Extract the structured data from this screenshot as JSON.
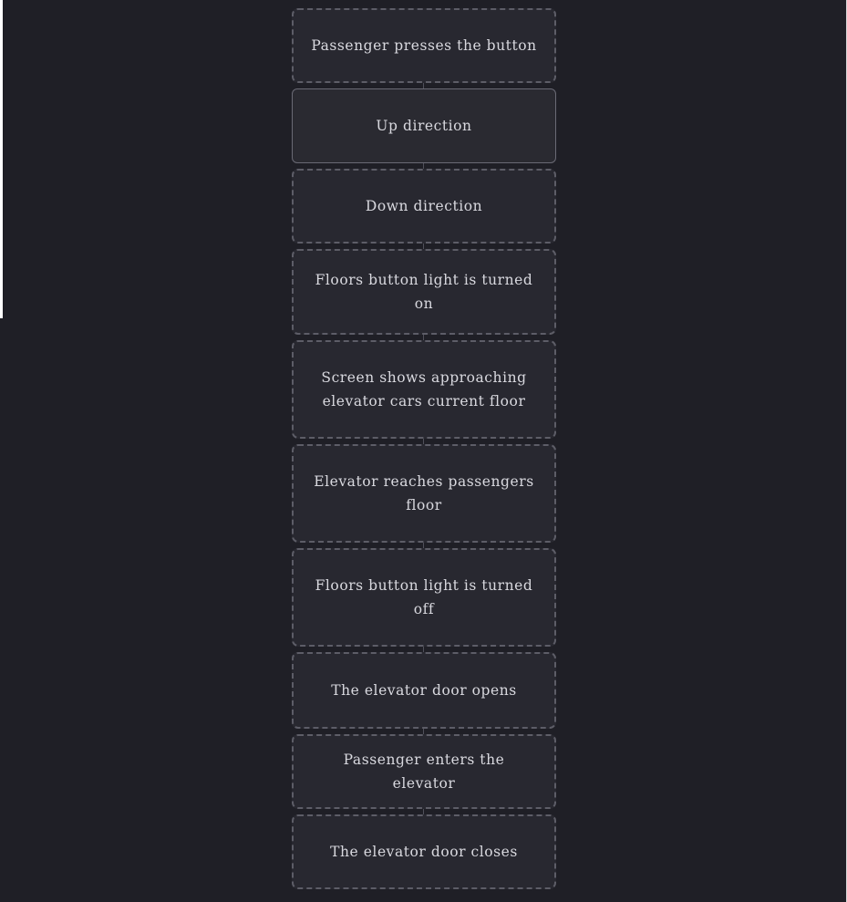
{
  "diagram": {
    "steps": [
      {
        "label": "Passenger presses the button",
        "selected": false
      },
      {
        "label": "Up direction",
        "selected": true
      },
      {
        "label": "Down direction",
        "selected": false
      },
      {
        "label": "Floors button light is turned on",
        "selected": false
      },
      {
        "label": "Screen shows approaching elevator cars current floor",
        "selected": false
      },
      {
        "label": "Elevator reaches passengers floor",
        "selected": false
      },
      {
        "label": "Floors button light is turned off",
        "selected": false
      },
      {
        "label": "The elevator door opens",
        "selected": false
      },
      {
        "label": "Passenger enters the elevator",
        "selected": false
      },
      {
        "label": "The elevator door closes",
        "selected": false
      }
    ]
  },
  "colors": {
    "background": "#1f1f26",
    "node_fill": "#282830",
    "node_border": "#5d5d67",
    "text": "#d9d9df"
  }
}
